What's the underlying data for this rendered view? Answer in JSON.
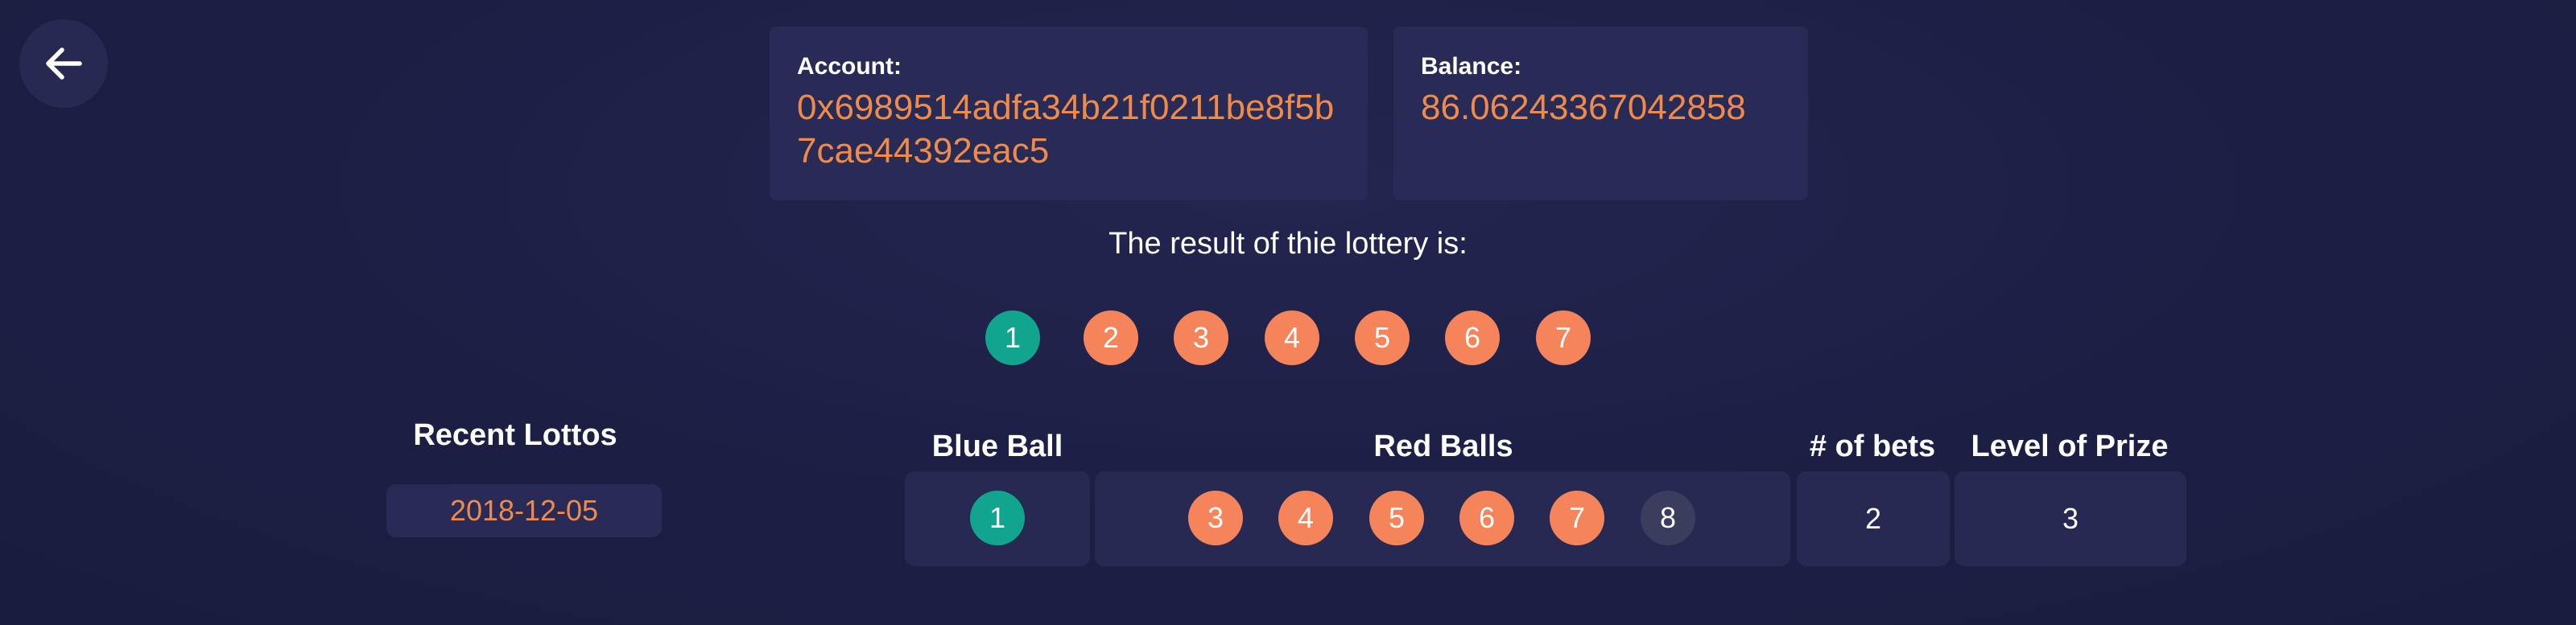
{
  "account": {
    "label": "Account:",
    "value": "0x6989514adfa34b21f0211be8f5b7cae44392eac5"
  },
  "balance": {
    "label": "Balance:",
    "value": "86.06243367042858"
  },
  "result": {
    "title": "The result of thie lottery is:",
    "blue_ball": "1",
    "red_balls": [
      "2",
      "3",
      "4",
      "5",
      "6",
      "7"
    ]
  },
  "recent": {
    "title": "Recent Lottos",
    "dates": [
      "2018-12-05"
    ]
  },
  "table": {
    "headers": {
      "blue": "Blue Ball",
      "red": "Red Balls",
      "bets": "# of bets",
      "prize": "Level of Prize"
    },
    "row": {
      "blue_ball": "1",
      "red_balls": [
        "3",
        "4",
        "5",
        "6",
        "7"
      ],
      "extra_ball": "8",
      "bets": "2",
      "prize": "3"
    }
  },
  "colors": {
    "blue_ball": "#12a58e",
    "red_ball": "#f6845a",
    "accent_text": "#f08a4b",
    "background": "#1c1f44"
  },
  "icons": {
    "back": "arrow-left-icon"
  }
}
